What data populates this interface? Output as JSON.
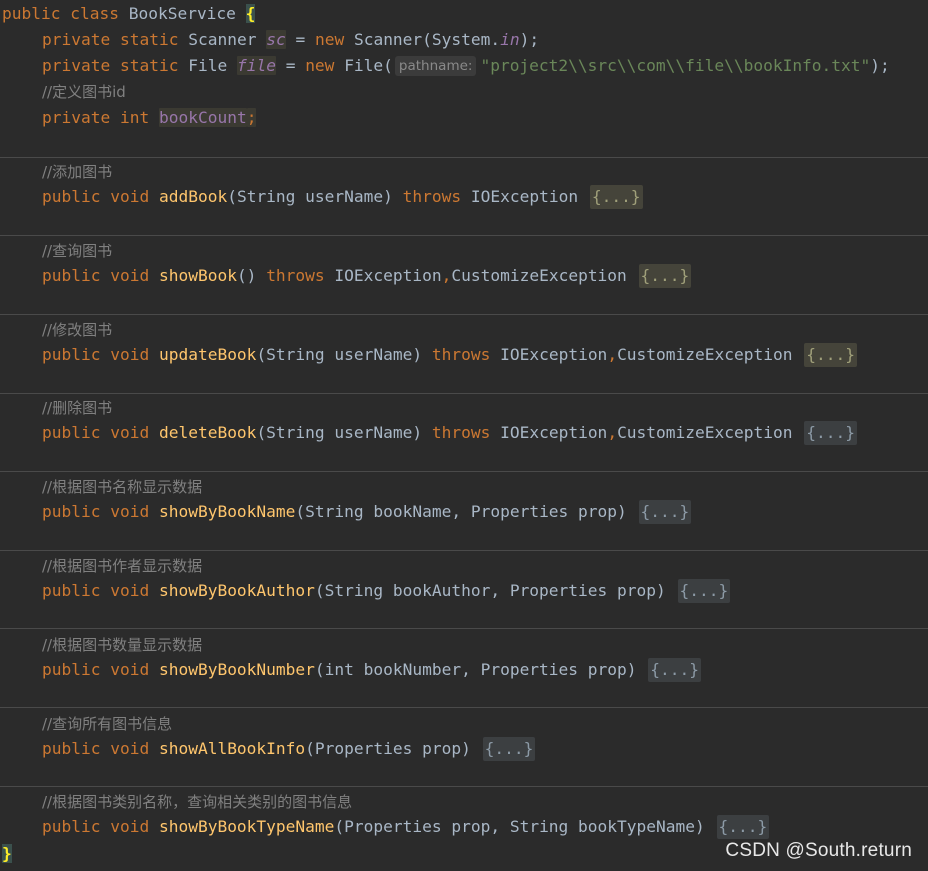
{
  "code": {
    "class_decl": {
      "kw1": "public",
      "kw2": "class",
      "name": "BookService",
      "open_brace": "{"
    },
    "field_sc": {
      "kw1": "private",
      "kw2": "static",
      "type": "Scanner",
      "name": "sc",
      "eq": "=",
      "new_kw": "new",
      "ctor": "Scanner(System.",
      "arg": "in",
      "tail": ");"
    },
    "field_file": {
      "kw1": "private",
      "kw2": "static",
      "type": "File",
      "name": "file",
      "eq": "=",
      "new_kw": "new",
      "ctor": "File(",
      "hint": "pathname:",
      "path": "\"project2\\\\src\\\\com\\\\file\\\\bookInfo.txt\"",
      "tail": ");"
    },
    "comment_bookcount": "//定义图书id",
    "field_count": {
      "kw1": "private",
      "kw2": "int",
      "name": "bookCount",
      "semi": ";"
    },
    "methods": [
      {
        "comment": "//添加图书",
        "mod": "public",
        "ret": "void",
        "name": "addBook",
        "params": "(String userName) ",
        "throws_kw": "throws",
        "throws_list": " IOException ",
        "fold": "{...}",
        "highlight": true
      },
      {
        "comment": "//查询图书",
        "mod": "public",
        "ret": "void",
        "name": "showBook",
        "params": "() ",
        "throws_kw": "throws",
        "throws_list": " IOException,CustomizeException ",
        "fold": "{...}",
        "highlight": true
      },
      {
        "comment": "//修改图书",
        "mod": "public",
        "ret": "void",
        "name": "updateBook",
        "params": "(String userName) ",
        "throws_kw": "throws",
        "throws_list": " IOException,CustomizeException ",
        "fold": "{...}",
        "highlight": true
      },
      {
        "comment": "//删除图书",
        "mod": "public",
        "ret": "void",
        "name": "deleteBook",
        "params": "(String userName) ",
        "throws_kw": "throws",
        "throws_list": " IOException,CustomizeException ",
        "fold": "{...}",
        "highlight": false
      },
      {
        "comment": "//根据图书名称显示数据",
        "mod": "public",
        "ret": "void",
        "name": "showByBookName",
        "params": "(String bookName, Properties prop) ",
        "throws_kw": "",
        "throws_list": "",
        "fold": "{...}",
        "highlight": false
      },
      {
        "comment": "//根据图书作者显示数据",
        "mod": "public",
        "ret": "void",
        "name": "showByBookAuthor",
        "params": "(String bookAuthor, Properties prop) ",
        "throws_kw": "",
        "throws_list": "",
        "fold": "{...}",
        "highlight": false
      },
      {
        "comment": "//根据图书数量显示数据",
        "mod": "public",
        "ret": "void",
        "name": "showByBookNumber",
        "params": "(int bookNumber, Properties prop) ",
        "throws_kw": "",
        "throws_list": "",
        "fold": "{...}",
        "highlight": false
      },
      {
        "comment": "//查询所有图书信息",
        "mod": "public",
        "ret": "void",
        "name": "showAllBookInfo",
        "params": "(Properties prop) ",
        "throws_kw": "",
        "throws_list": "",
        "fold": "{...}",
        "highlight": false
      },
      {
        "comment": "//根据图书类别名称，查询相关类别的图书信息",
        "mod": "public",
        "ret": "void",
        "name": "showByBookTypeName",
        "params": "(Properties prop, String bookTypeName) ",
        "throws_kw": "",
        "throws_list": "",
        "fold": "{...}",
        "highlight": false
      }
    ],
    "close_brace": "}"
  },
  "watermark": "CSDN @South.return",
  "colors": {
    "background": "#2b2b2b",
    "keyword": "#cc7832",
    "method": "#ffc66d",
    "field": "#9876aa",
    "string": "#6a8759",
    "comment": "#808080",
    "text": "#a9b7c6"
  }
}
